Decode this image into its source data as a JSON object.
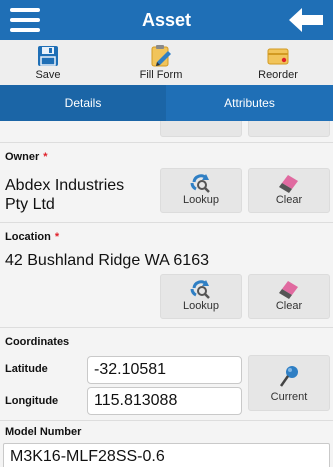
{
  "header": {
    "title": "Asset"
  },
  "toolbar": {
    "save_label": "Save",
    "fill_form_label": "Fill Form",
    "reorder_label": "Reorder"
  },
  "tabs": [
    {
      "label": "Details",
      "active": true
    },
    {
      "label": "Attributes",
      "active": false
    }
  ],
  "owner": {
    "label": "Owner",
    "required_mark": "*",
    "value_line1": "Abdex Industries",
    "value_line2": "Pty Ltd",
    "lookup_label": "Lookup",
    "clear_label": "Clear"
  },
  "location": {
    "label": "Location",
    "required_mark": "*",
    "value": "42 Bushland Ridge WA 6163",
    "lookup_label": "Lookup",
    "clear_label": "Clear"
  },
  "coordinates": {
    "label": "Coordinates",
    "latitude_label": "Latitude",
    "latitude_value": "-32.10581",
    "longitude_label": "Longitude",
    "longitude_value": "115.813088",
    "current_label": "Current"
  },
  "model_number": {
    "label": "Model Number",
    "value": "M3K16-MLF28SS-0.6"
  },
  "colors": {
    "primary": "#1f6fb6",
    "required": "#e0202a",
    "toolbar_bg": "#eeeeee",
    "content_bg": "#f4f4f4"
  },
  "icons": {
    "menu": "hamburger-menu-icon",
    "back": "arrow-left-icon",
    "save": "floppy-disk-icon",
    "fill_form": "clipboard-pencil-icon",
    "reorder": "reorder-card-icon",
    "lookup": "refresh-search-icon",
    "clear": "eraser-icon",
    "current": "location-pin-icon"
  }
}
